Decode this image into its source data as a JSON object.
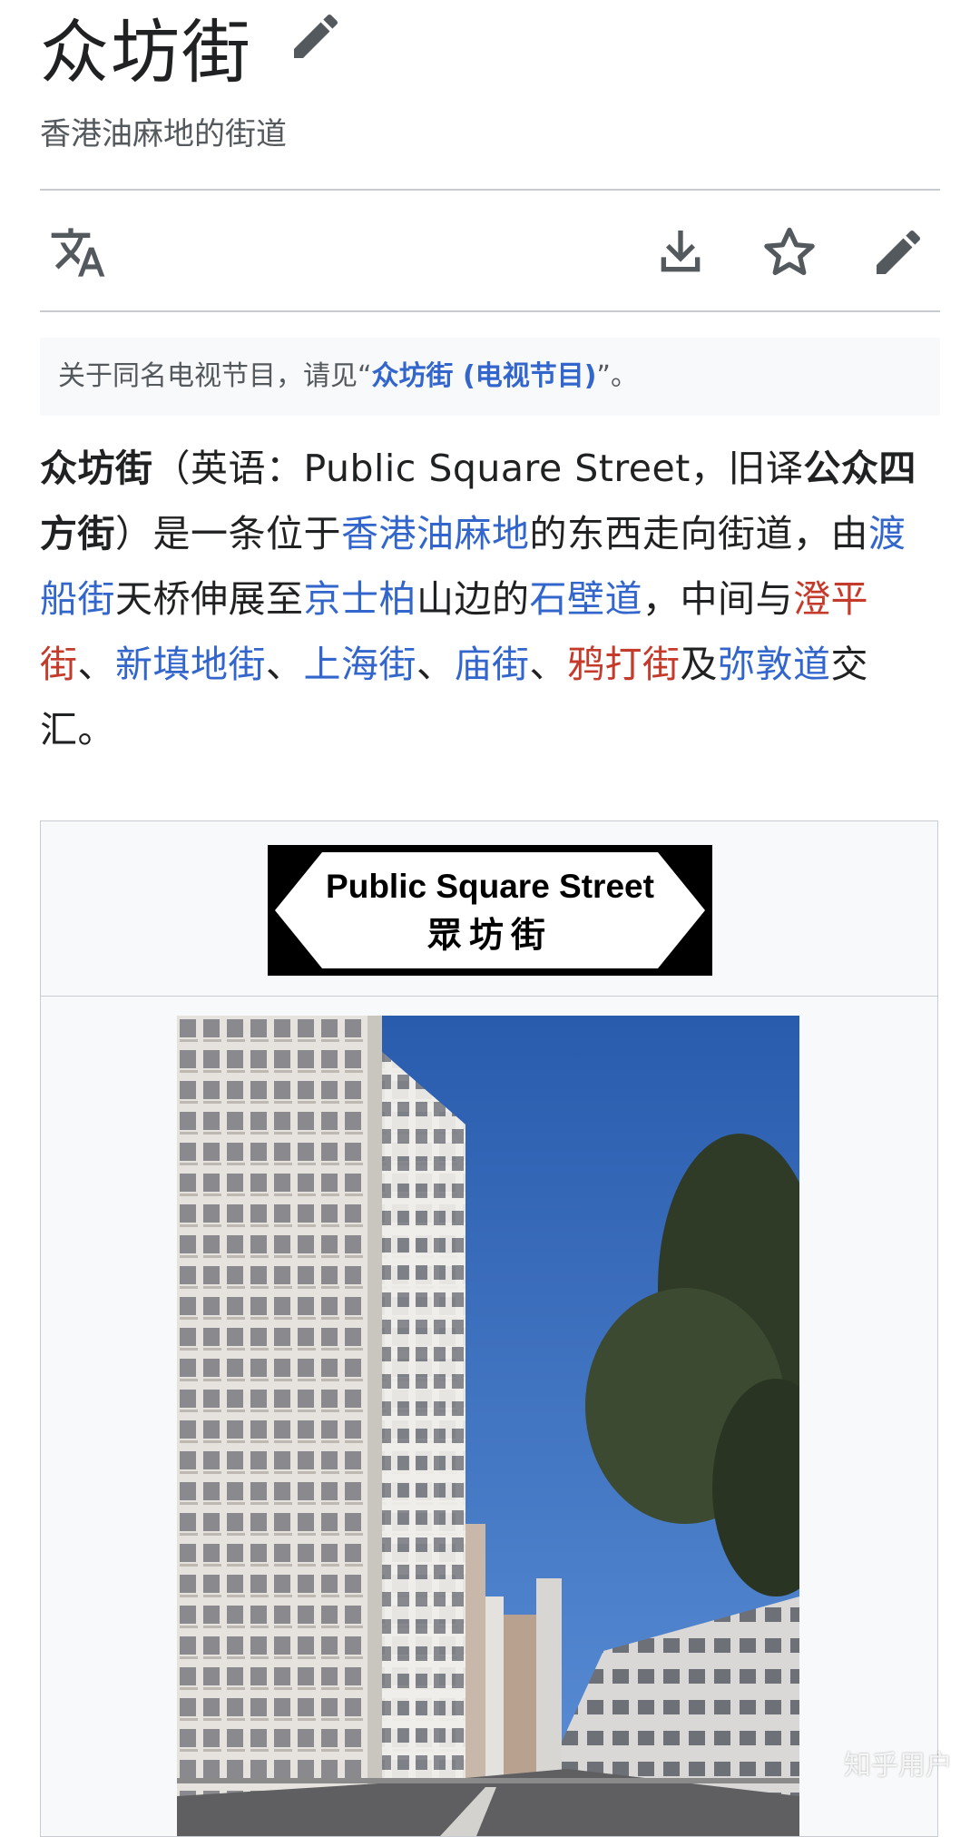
{
  "title": "众坊街",
  "subtitle": "香港油麻地的街道",
  "toolbar": {
    "language_icon": "translate-icon",
    "download_icon": "download-icon",
    "star_icon": "star-icon",
    "edit_icon": "pencil-icon"
  },
  "hatnote": {
    "prefix": "关于同名电视节目，请见“",
    "link": "众坊街 (电视节目)",
    "suffix": "”。"
  },
  "lead": {
    "term": "众坊街",
    "t1": "（英语：Public Square Street，旧译",
    "alt_name": "公众四方街",
    "t2": "）是一条位于",
    "link_yaumatei": "香港油麻地",
    "t3": "的东西走向街道，由",
    "link_ferry": "渡船街",
    "t4": "天桥伸展至",
    "link_kingsgeorge": "京士柏",
    "t5": "山边的",
    "link_wallroad": "石壁道",
    "t6": "，中间与",
    "link_chingping": "澄平街",
    "t7": "、",
    "link_sandfill": "新填地街",
    "t8": "、",
    "link_shanghai": "上海街",
    "t9": "、",
    "link_temple": "庙街",
    "t10": "、",
    "link_battery": "鸦打街",
    "t11": "及",
    "link_nathan": "弥敦道",
    "t12": "交汇。"
  },
  "infobox": {
    "sign_line1": "Public Square Street",
    "sign_line2": "眾坊街"
  },
  "watermark": "知乎用户",
  "colors": {
    "link": "#3366cc",
    "redlink": "#c43a2b",
    "text": "#202122",
    "muted": "#54595d",
    "sky": "#2f63b4"
  }
}
